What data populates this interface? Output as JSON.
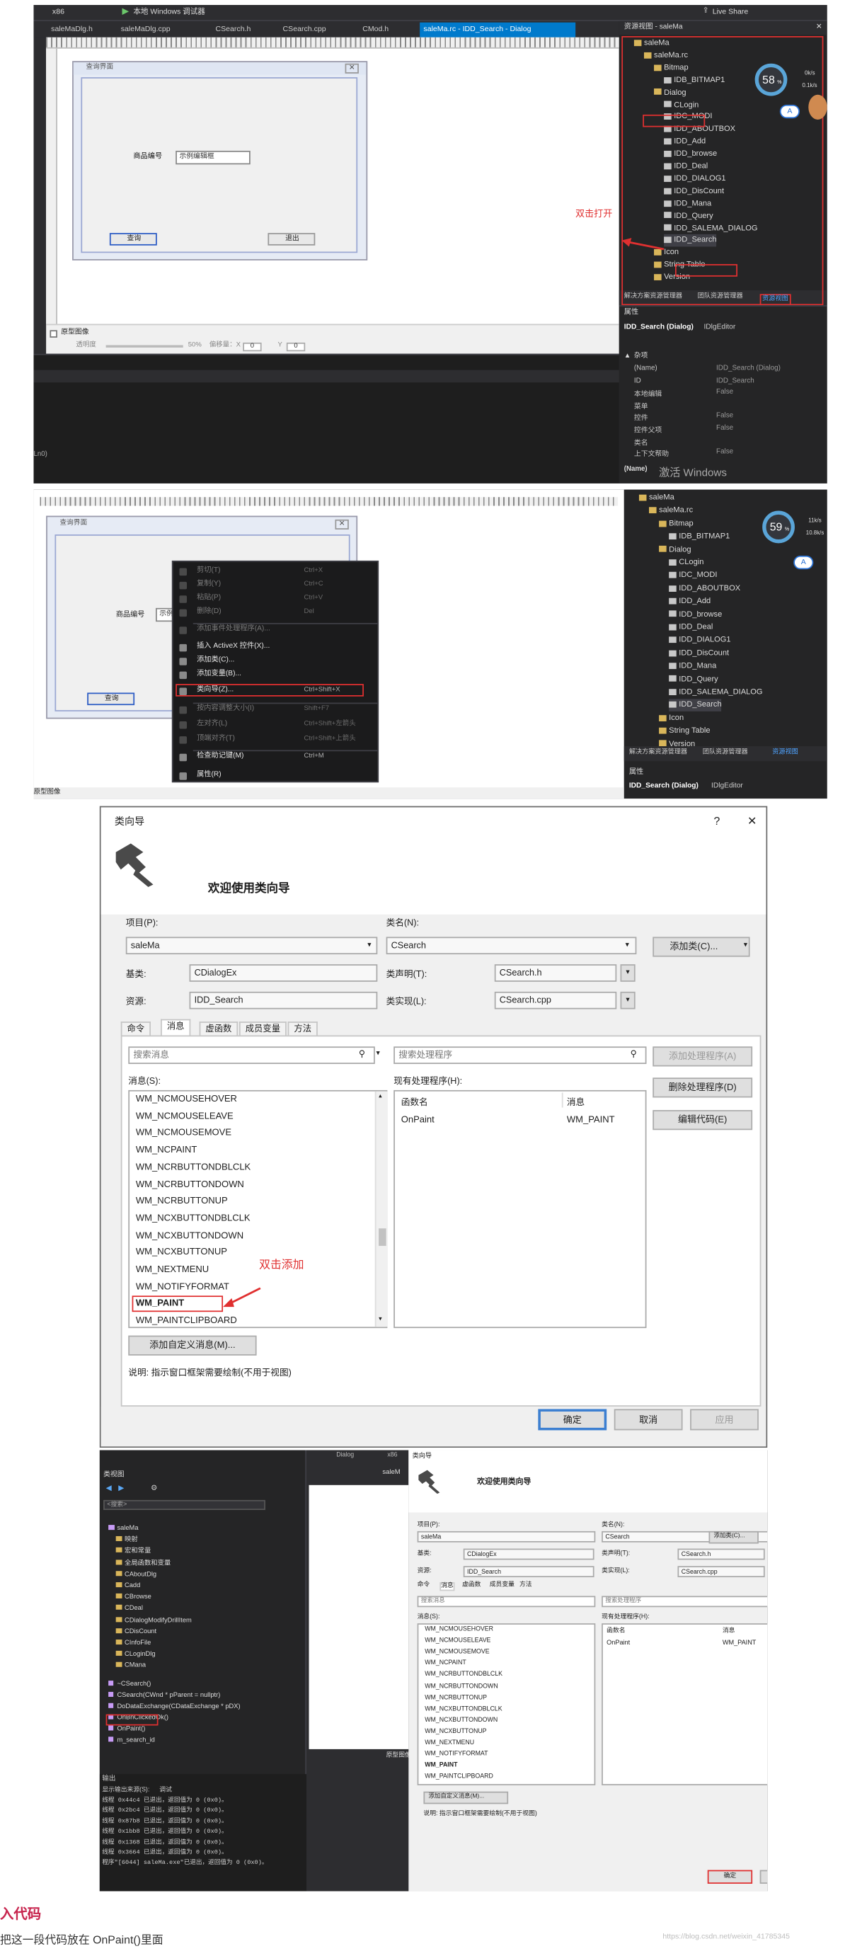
{
  "s1": {
    "toolbar": {
      "platform": "x86",
      "debugger": "本地 Windows 调试器",
      "live_share": "Live Share"
    },
    "tabs": [
      "saleMaDlg.h",
      "saleMaDlg.cpp",
      "CSearch.h",
      "CSearch.cpp",
      "CMod.h",
      "saleMa.rc - IDD_Search - Dialog"
    ],
    "dialog": {
      "title": "查询界面",
      "field_label": "商品编号",
      "edit_value": "示例编辑框",
      "query_btn": "查询",
      "exit_btn": "退出"
    },
    "bottom_row": {
      "checkbox": "原型图像",
      "transparency_label": "透明度",
      "transparency_value": "50%",
      "offset_label": "偏移量：X",
      "offset_x": "0",
      "y_label": "Y",
      "offset_y": "0"
    },
    "resource_view": {
      "title": "资源视图 - saleMa",
      "nodes": [
        "saleMa",
        "saleMa.rc",
        "Bitmap",
        "IDB_BITMAP1",
        "Dialog",
        "CLogin",
        "IDC_MODI",
        "IDD_ABOUTBOX",
        "IDD_Add",
        "IDD_browse",
        "IDD_Deal",
        "IDD_DIALOG1",
        "IDD_DisCount",
        "IDD_Mana",
        "IDD_Query",
        "IDD_SALEMA_DIALOG",
        "IDD_Search",
        "Icon",
        "String Table",
        "Version"
      ],
      "tabs": [
        "解决方案资源管理器",
        "团队资源管理器",
        "资源视图"
      ]
    },
    "gauge": {
      "value": "58",
      "unit": "%",
      "up": "0k/s",
      "down": "0.1k/s"
    },
    "badge": "A",
    "annotation": "双击打开",
    "properties": {
      "header": "属性",
      "object": "IDD_Search (Dialog)",
      "editor": "IDlgEditor",
      "group": "杂项",
      "rows": [
        {
          "k": "(Name)",
          "v": "IDD_Search (Dialog)"
        },
        {
          "k": "ID",
          "v": "IDD_Search"
        },
        {
          "k": "本地编辑",
          "v": "False"
        },
        {
          "k": "菜单",
          "v": ""
        },
        {
          "k": "控件",
          "v": "False"
        },
        {
          "k": "控件父项",
          "v": "False"
        },
        {
          "k": "类名",
          "v": ""
        },
        {
          "k": "上下文帮助",
          "v": "False"
        }
      ],
      "footer": "(Name)",
      "watermark": "激活 Windows"
    },
    "status_left": "Ln0)"
  },
  "s2": {
    "dialog": {
      "title": "查询界面",
      "field_label": "商品编号",
      "edit_value": "示例",
      "query_btn": "查询"
    },
    "context_menu": [
      {
        "label": "剪切(T)",
        "shortcut": "Ctrl+X",
        "enabled": false
      },
      {
        "label": "复制(Y)",
        "shortcut": "Ctrl+C",
        "enabled": false
      },
      {
        "label": "粘贴(P)",
        "shortcut": "Ctrl+V",
        "enabled": false
      },
      {
        "label": "删除(D)",
        "shortcut": "Del",
        "enabled": false
      },
      {
        "label": "添加事件处理程序(A)...",
        "shortcut": "",
        "enabled": false
      },
      {
        "label": "插入 ActiveX 控件(X)...",
        "shortcut": "",
        "enabled": true
      },
      {
        "label": "添加类(C)...",
        "shortcut": "",
        "enabled": true
      },
      {
        "label": "添加变量(B)...",
        "shortcut": "",
        "enabled": true
      },
      {
        "label": "类向导(Z)...",
        "shortcut": "Ctrl+Shift+X",
        "enabled": true
      },
      {
        "label": "按内容调整大小(I)",
        "shortcut": "Shift+F7",
        "enabled": false
      },
      {
        "label": "左对齐(L)",
        "shortcut": "Ctrl+Shift+左箭头",
        "enabled": false
      },
      {
        "label": "顶端对齐(T)",
        "shortcut": "Ctrl+Shift+上箭头",
        "enabled": false
      },
      {
        "label": "检查助记键(M)",
        "shortcut": "Ctrl+M",
        "enabled": true
      },
      {
        "label": "属性(R)",
        "shortcut": "",
        "enabled": true
      }
    ],
    "resource_view": {
      "nodes": [
        "saleMa",
        "saleMa.rc",
        "Bitmap",
        "IDB_BITMAP1",
        "Dialog",
        "CLogin",
        "IDC_MODI",
        "IDD_ABOUTBOX",
        "IDD_Add",
        "IDD_browse",
        "IDD_Deal",
        "IDD_DIALOG1",
        "IDD_DisCount",
        "IDD_Mana",
        "IDD_Query",
        "IDD_SALEMA_DIALOG",
        "IDD_Search",
        "Icon",
        "String Table",
        "Version"
      ],
      "tabs": [
        "解决方案资源管理器",
        "团队资源管理器",
        "资源视图"
      ],
      "props_header": "属性",
      "props_object": "IDD_Search (Dialog)",
      "props_editor": "IDlgEditor"
    },
    "gauge": {
      "value": "59",
      "unit": "%",
      "up": "11k/s",
      "down": "10.8k/s"
    },
    "badge": "A",
    "status_left": "原型图像"
  },
  "wizard": {
    "title": "类向导",
    "help": "?",
    "close": "✕",
    "heading": "欢迎使用类向导",
    "project_label": "项目(P):",
    "project_value": "saleMa",
    "classname_label": "类名(N):",
    "classname_value": "CSearch",
    "add_class_btn": "添加类(C)...",
    "base_label": "基类:",
    "base_value": "CDialogEx",
    "decl_label": "类声明(T):",
    "decl_value": "CSearch.h",
    "res_label": "资源:",
    "res_value": "IDD_Search",
    "impl_label": "类实现(L):",
    "impl_value": "CSearch.cpp",
    "tabs": [
      "命令",
      "消息",
      "虚函数",
      "成员变量",
      "方法"
    ],
    "search_msg_placeholder": "搜索消息",
    "search_handler_placeholder": "搜索处理程序",
    "messages_label": "消息(S):",
    "handlers_label": "现有处理程序(H):",
    "messages": [
      "WM_NCMOUSEHOVER",
      "WM_NCMOUSELEAVE",
      "WM_NCMOUSEMOVE",
      "WM_NCPAINT",
      "WM_NCRBUTTONDBLCLK",
      "WM_NCRBUTTONDOWN",
      "WM_NCRBUTTONUP",
      "WM_NCXBUTTONDBLCLK",
      "WM_NCXBUTTONDOWN",
      "WM_NCXBUTTONUP",
      "WM_NEXTMENU",
      "WM_NOTIFYFORMAT",
      "WM_PAINT",
      "WM_PAINTCLIPBOARD"
    ],
    "handler_col_func": "函数名",
    "handler_col_msg": "消息",
    "handlers": [
      {
        "func": "OnPaint",
        "msg": "WM_PAINT"
      }
    ],
    "add_handler_btn": "添加处理程序(A)",
    "delete_handler_btn": "删除处理程序(D)",
    "edit_code_btn": "编辑代码(E)",
    "add_custom_btn": "添加自定义消息(M)...",
    "desc": "说明:   指示窗口框架需要绘制(不用于视图)",
    "ok_btn": "确定",
    "cancel_btn": "取消",
    "apply_btn": "应用",
    "annotation": "双击添加"
  },
  "s4": {
    "class_view_title": "类视图",
    "search_placeholder": "<搜索>",
    "class_nodes": [
      "saleMa",
      "映射",
      "宏和常量",
      "全局函数和变量",
      "CAboutDlg",
      "Cadd",
      "CBrowse",
      "CDeal",
      "CDialogModifyDrillItem",
      "CDisCount",
      "CInfoFile",
      "CLoginDlg",
      "CMana"
    ],
    "members": [
      "~CSearch()",
      "CSearch(CWnd * pParent = nullptr)",
      "DoDataExchange(CDataExchange * pDX)",
      "OnBnClickedOk()",
      "OnPaint()",
      "m_search_id"
    ],
    "output_label": "输出",
    "output_source": "显示输出来源(S):",
    "output_source_value": "调试",
    "output_lines": [
      "线程 0x44c4 已退出，返回值为 0 (0x0)。",
      "线程 0x2bc4 已退出，返回值为 0 (0x0)。",
      "线程 0x87b8 已退出，返回值为 0 (0x0)。",
      "线程 0x1bb8 已退出，返回值为 0 (0x0)。",
      "线程 0x1368 已退出，返回值为 0 (0x0)。",
      "线程 0x3664 已退出，返回值为 0 (0x0)。",
      "程序\"[6044] saleMa.exe\"已退出，返回值为 0 (0x0)。"
    ],
    "tab_top": "Dialog",
    "tab_top2": "x86",
    "tab_top3": "saleM",
    "checkbox": "原型图像"
  },
  "footer": {
    "heading": "入代码",
    "text": "把这一段代码放在 OnPaint()里面",
    "watermark": "https://blog.csdn.net/weixin_41785345"
  }
}
